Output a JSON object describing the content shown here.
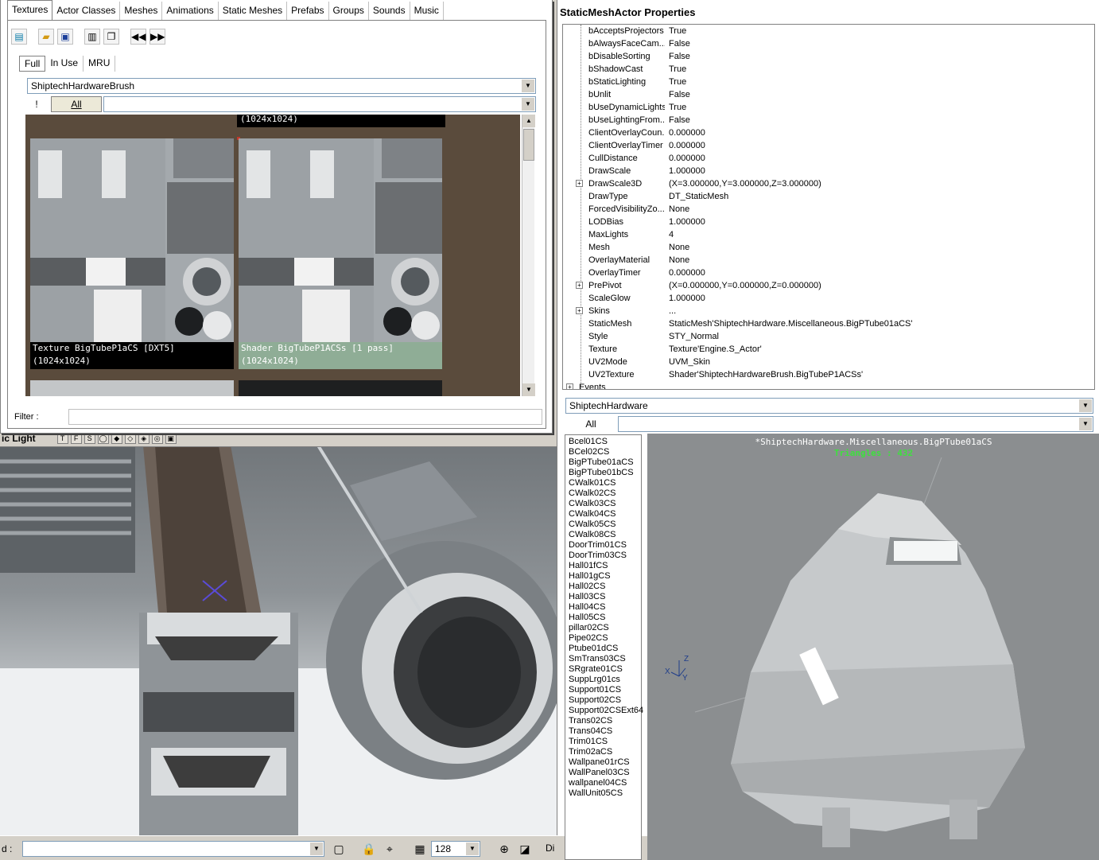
{
  "browser": {
    "tabs": [
      "Textures",
      "Actor Classes",
      "Meshes",
      "Animations",
      "Static Meshes",
      "Prefabs",
      "Groups",
      "Sounds",
      "Music"
    ],
    "active_tab": 0,
    "subtabs": [
      "Full",
      "In Use",
      "MRU"
    ],
    "package": "ShiptechHardwareBrush",
    "exclusion_label": "!",
    "group_all_label": "All",
    "textures": [
      {
        "caption": "Texture BigTubeP1aCS [DXT5]\n(1024x1024)",
        "selected": false
      },
      {
        "caption": "Shader BigTubeP1ACSs [1 pass]\n(1024x1024)",
        "selected": true
      }
    ],
    "partial_top_caption": "(1024x1024)",
    "filter_label": "Filter :"
  },
  "viewport": {
    "label": "ic Light",
    "toolbar_buttons": [
      "T",
      "F",
      "S"
    ]
  },
  "statusbar": {
    "label": "d :",
    "grid_value": "128",
    "right_label": "Di"
  },
  "props": {
    "title": "StaticMeshActor Properties",
    "rows": [
      {
        "name": "bAcceptsProjectors",
        "value": "True",
        "expand": false
      },
      {
        "name": "bAlwaysFaceCam...",
        "value": "False",
        "expand": false
      },
      {
        "name": "bDisableSorting",
        "value": "False",
        "expand": false
      },
      {
        "name": "bShadowCast",
        "value": "True",
        "expand": false
      },
      {
        "name": "bStaticLighting",
        "value": "True",
        "expand": false
      },
      {
        "name": "bUnlit",
        "value": "False",
        "expand": false
      },
      {
        "name": "bUseDynamicLights",
        "value": "True",
        "expand": false
      },
      {
        "name": "bUseLightingFrom...",
        "value": "False",
        "expand": false
      },
      {
        "name": "ClientOverlayCoun...",
        "value": "0.000000",
        "expand": false
      },
      {
        "name": "ClientOverlayTimer",
        "value": "0.000000",
        "expand": false
      },
      {
        "name": "CullDistance",
        "value": "0.000000",
        "expand": false
      },
      {
        "name": "DrawScale",
        "value": "1.000000",
        "expand": false
      },
      {
        "name": "DrawScale3D",
        "value": "(X=3.000000,Y=3.000000,Z=3.000000)",
        "expand": true
      },
      {
        "name": "DrawType",
        "value": "DT_StaticMesh",
        "expand": false
      },
      {
        "name": "ForcedVisibilityZo...",
        "value": "None",
        "expand": false
      },
      {
        "name": "LODBias",
        "value": "1.000000",
        "expand": false
      },
      {
        "name": "MaxLights",
        "value": "4",
        "expand": false
      },
      {
        "name": "Mesh",
        "value": "None",
        "expand": false
      },
      {
        "name": "OverlayMaterial",
        "value": "None",
        "expand": false
      },
      {
        "name": "OverlayTimer",
        "value": "0.000000",
        "expand": false
      },
      {
        "name": "PrePivot",
        "value": "(X=0.000000,Y=0.000000,Z=0.000000)",
        "expand": true
      },
      {
        "name": "ScaleGlow",
        "value": "1.000000",
        "expand": false
      },
      {
        "name": "Skins",
        "value": "...",
        "expand": true
      },
      {
        "name": "StaticMesh",
        "value": "StaticMesh'ShiptechHardware.Miscellaneous.BigPTube01aCS'",
        "expand": false
      },
      {
        "name": "Style",
        "value": "STY_Normal",
        "expand": false
      },
      {
        "name": "Texture",
        "value": "Texture'Engine.S_Actor'",
        "expand": false
      },
      {
        "name": "UV2Mode",
        "value": "UVM_Skin",
        "expand": false
      },
      {
        "name": "UV2Texture",
        "value": "Shader'ShiptechHardwareBrush.BigTubeP1ACSs'",
        "expand": false
      }
    ],
    "partial_category": "Events"
  },
  "mesh": {
    "package": "ShiptechHardware",
    "group_all_label": "All",
    "items": [
      "Bcel01CS",
      "BCel02CS",
      "BigPTube01aCS",
      "BigPTube01bCS",
      "CWalk01CS",
      "CWalk02CS",
      "CWalk03CS",
      "CWalk04CS",
      "CWalk05CS",
      "CWalk08CS",
      "DoorTrim01CS",
      "DoorTrim03CS",
      "Hall01fCS",
      "Hall01gCS",
      "Hall02CS",
      "Hall03CS",
      "Hall04CS",
      "Hall05CS",
      "pillar02CS",
      "Pipe02CS",
      "Ptube01dCS",
      "SmTrans03CS",
      "SRgrate01CS",
      "SuppLrg01cs",
      "Support01CS",
      "Support02CS",
      "Support02CSExt64",
      "Trans02CS",
      "Trans04CS",
      "Trim01CS",
      "Trim02aCS",
      "Wallpane01rCS",
      "WallPanel03CS",
      "wallpanel04CS",
      "WallUnit05CS"
    ],
    "preview_title": "*ShiptechHardware.Miscellaneous.BigPTube01aCS",
    "triangles_label": "Triangles : 432",
    "axis_labels": [
      "Z",
      "X",
      "Y"
    ]
  }
}
